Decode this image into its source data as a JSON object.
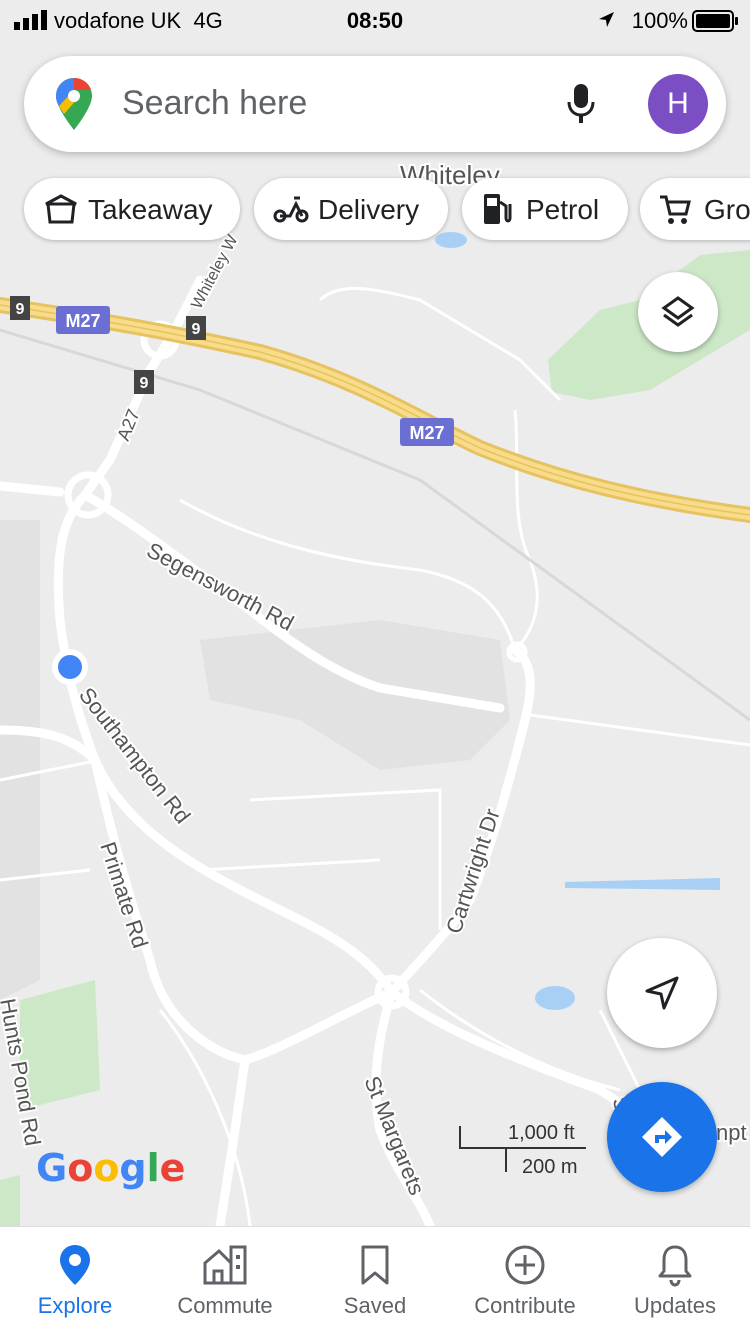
{
  "status_bar": {
    "carrier": "vodafone UK",
    "network": "4G",
    "time": "08:50",
    "battery": "100%"
  },
  "search": {
    "placeholder": "Search here",
    "avatar_letter": "H"
  },
  "chips": [
    {
      "label": "Takeaway",
      "icon": "takeaway-icon"
    },
    {
      "label": "Delivery",
      "icon": "delivery-icon"
    },
    {
      "label": "Petrol",
      "icon": "petrol-icon"
    },
    {
      "label": "Gro",
      "icon": "groceries-icon"
    }
  ],
  "map_labels": {
    "whiteley": "Whiteley",
    "whiteley_way": "Whiteley W",
    "m27_a": "M27",
    "m27_b": "M27",
    "junction_a": "9",
    "junction_b": "9",
    "junction_c": "9",
    "a27": "A27",
    "segensworth": "Segensworth Rd",
    "southampton": "Southampton Rd",
    "primate": "Primate Rd",
    "cartwright": "Cartwright Dr",
    "st_margarets": "St Margarets",
    "hunts_pond": "Hunts Pond Rd",
    "partial_right": "S",
    "partial_right2": "npt"
  },
  "scale": {
    "feet": "1,000 ft",
    "meters": "200 m"
  },
  "attribution": {
    "g1": "G",
    "o1": "o",
    "o2": "o",
    "g2": "g",
    "l": "l",
    "e": "e"
  },
  "colors": {
    "accent": "#1a73e8",
    "avatar": "#7b4fc3",
    "motorway_badge": "#6b6fd4",
    "park": "#cde8c7"
  },
  "nav": [
    {
      "label": "Explore",
      "active": true
    },
    {
      "label": "Commute",
      "active": false
    },
    {
      "label": "Saved",
      "active": false
    },
    {
      "label": "Contribute",
      "active": false
    },
    {
      "label": "Updates",
      "active": false
    }
  ]
}
